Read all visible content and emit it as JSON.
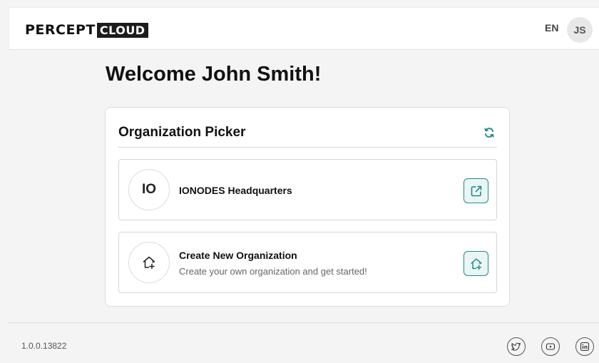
{
  "header": {
    "logo_main": "PERCEPT",
    "logo_badge": "CLOUD",
    "language": "EN",
    "user_initials": "JS"
  },
  "welcome": "Welcome John Smith!",
  "picker": {
    "title": "Organization Picker",
    "refresh_icon": "refresh-icon",
    "organizations": [
      {
        "initials": "IO",
        "name": "IONODES Headquarters",
        "action_icon": "external-link-icon"
      }
    ],
    "create": {
      "icon": "home-plus-icon",
      "title": "Create New Organization",
      "subtitle": "Create your own organization and get started!",
      "action_icon": "home-plus-icon"
    }
  },
  "footer": {
    "version": "1.0.0.13822",
    "social": [
      "twitter-icon",
      "youtube-icon",
      "linkedin-icon"
    ]
  },
  "colors": {
    "accent": "#1f8a87",
    "accent_bg": "#eaf6f6",
    "page_bg": "#f4f4f4"
  }
}
